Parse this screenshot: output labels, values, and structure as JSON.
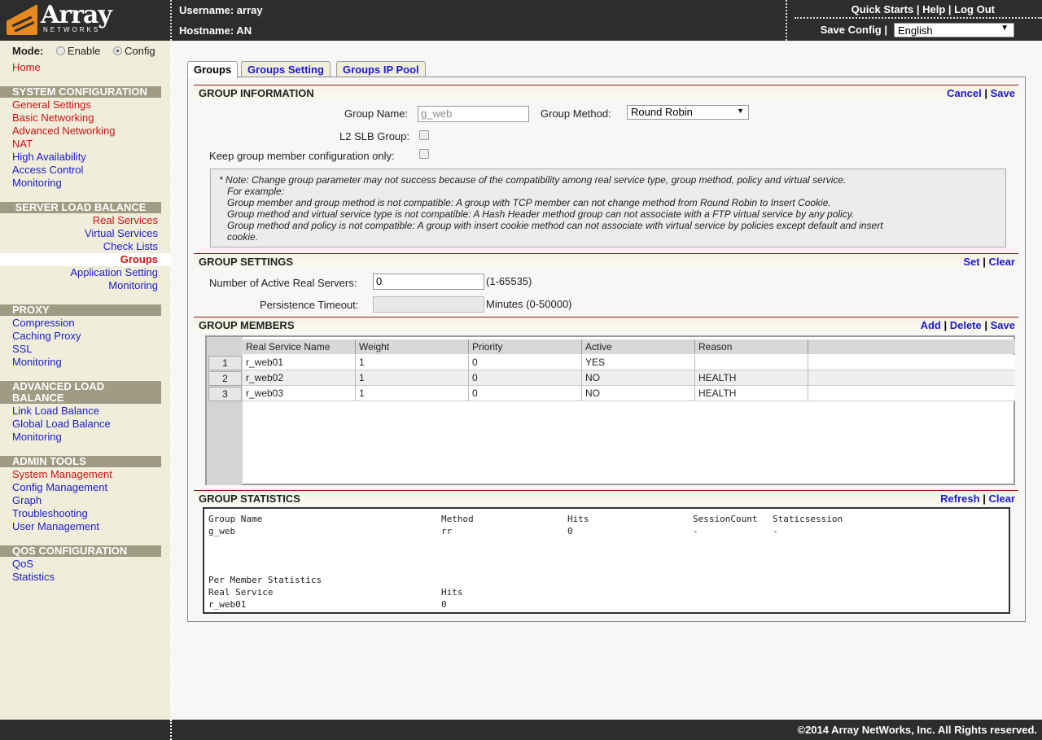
{
  "header": {
    "logo_text": "Array",
    "logo_sub": "NETWORKS",
    "username_label": "Username: array",
    "hostname_label": "Hostname: AN",
    "quick_starts": "Quick Starts",
    "help": "Help",
    "logout": "Log Out",
    "save_config": "Save Config",
    "language": "English"
  },
  "sidebar": {
    "mode_label": "Mode:",
    "enable": "Enable",
    "config": "Config",
    "home": "Home",
    "system_configuration": {
      "title": "SYSTEM CONFIGURATION",
      "items": [
        "General Settings",
        "Basic Networking",
        "Advanced Networking",
        "NAT",
        "High Availability",
        "Access Control",
        "Monitoring"
      ]
    },
    "server_load_balance": {
      "title": "SERVER LOAD BALANCE",
      "items": [
        "Real Services",
        "Virtual Services",
        "Check Lists",
        "Groups",
        "Application Setting",
        "Monitoring"
      ]
    },
    "proxy": {
      "title": "PROXY",
      "items": [
        "Compression",
        "Caching Proxy",
        "SSL",
        "Monitoring"
      ]
    },
    "advanced_load_balance": {
      "title_line1": "ADVANCED LOAD",
      "title_line2": "BALANCE",
      "items": [
        "Link Load Balance",
        "Global Load Balance",
        "Monitoring"
      ]
    },
    "admin_tools": {
      "title": "ADMIN TOOLS",
      "items": [
        "System Management",
        "Config Management",
        "Graph",
        "Troubleshooting",
        "User Management"
      ]
    },
    "qos_configuration": {
      "title": "QOS CONFIGURATION",
      "items": [
        "QoS",
        "Statistics"
      ]
    }
  },
  "tabs": [
    "Groups",
    "Groups Setting",
    "Groups IP Pool"
  ],
  "group_information": {
    "title": "GROUP INFORMATION",
    "cancel": "Cancel",
    "save": "Save",
    "group_name_label": "Group Name:",
    "group_name_value": "g_web",
    "group_method_label": "Group Method:",
    "group_method_value": "Round Robin",
    "l2_slb_label": "L2 SLB Group:",
    "keep_member_label": "Keep group member configuration only:",
    "note": [
      "* Note: Change group parameter may not success because of the compatibility among real service type, group method, policy and virtual service.",
      "For example:",
      "Group member and group method is not compatible: A group with TCP member can not change method from Round Robin to Insert Cookie.",
      "Group method and virtual service type is not compatible: A Hash Header method group can not associate with a FTP virtual service by any policy.",
      "Group method and policy is not compatible: A group with insert cookie method can not associate with virtual service by policies except default and insert",
      "cookie."
    ]
  },
  "group_settings": {
    "title": "GROUP SETTINGS",
    "set": "Set",
    "clear": "Clear",
    "active_servers_label": "Number of Active Real Servers:",
    "active_servers_value": "0",
    "active_servers_hint": "(1-65535)",
    "persistence_label": "Persistence Timeout:",
    "persistence_value": "",
    "persistence_hint": "Minutes (0-50000)"
  },
  "group_members": {
    "title": "GROUP MEMBERS",
    "add": "Add",
    "delete": "Delete",
    "save": "Save",
    "columns": [
      "Real Service Name",
      "Weight",
      "Priority",
      "Active",
      "Reason"
    ],
    "rows": [
      {
        "num": "1",
        "name": "r_web01",
        "weight": "1",
        "priority": "0",
        "active": "YES",
        "reason": ""
      },
      {
        "num": "2",
        "name": "r_web02",
        "weight": "1",
        "priority": "0",
        "active": "NO",
        "reason": "HEALTH"
      },
      {
        "num": "3",
        "name": "r_web03",
        "weight": "1",
        "priority": "0",
        "active": "NO",
        "reason": "HEALTH"
      }
    ]
  },
  "group_statistics": {
    "title": "GROUP STATISTICS",
    "refresh": "Refresh",
    "clear": "Clear",
    "headers": [
      "Group Name",
      "Method",
      "Hits",
      "SessionCount",
      "Staticsession"
    ],
    "values": [
      "g_web",
      "rr",
      "0",
      "-",
      "-"
    ],
    "per_member_title": "Per Member Statistics",
    "member_headers": [
      "Real Service",
      "Hits"
    ],
    "member_values": [
      "r_web01",
      "0"
    ]
  },
  "footer": {
    "copyright": "©2014 Array NetWorks, Inc. All Rights reserved."
  },
  "colors": {
    "topbar": "#2d2d2d",
    "sidebar_bg": "#f0eedb",
    "section_head": "#9f9c83",
    "link_blue": "#1a1acc",
    "link_red": "#cc1111",
    "logo_orange": "#e8891e"
  }
}
